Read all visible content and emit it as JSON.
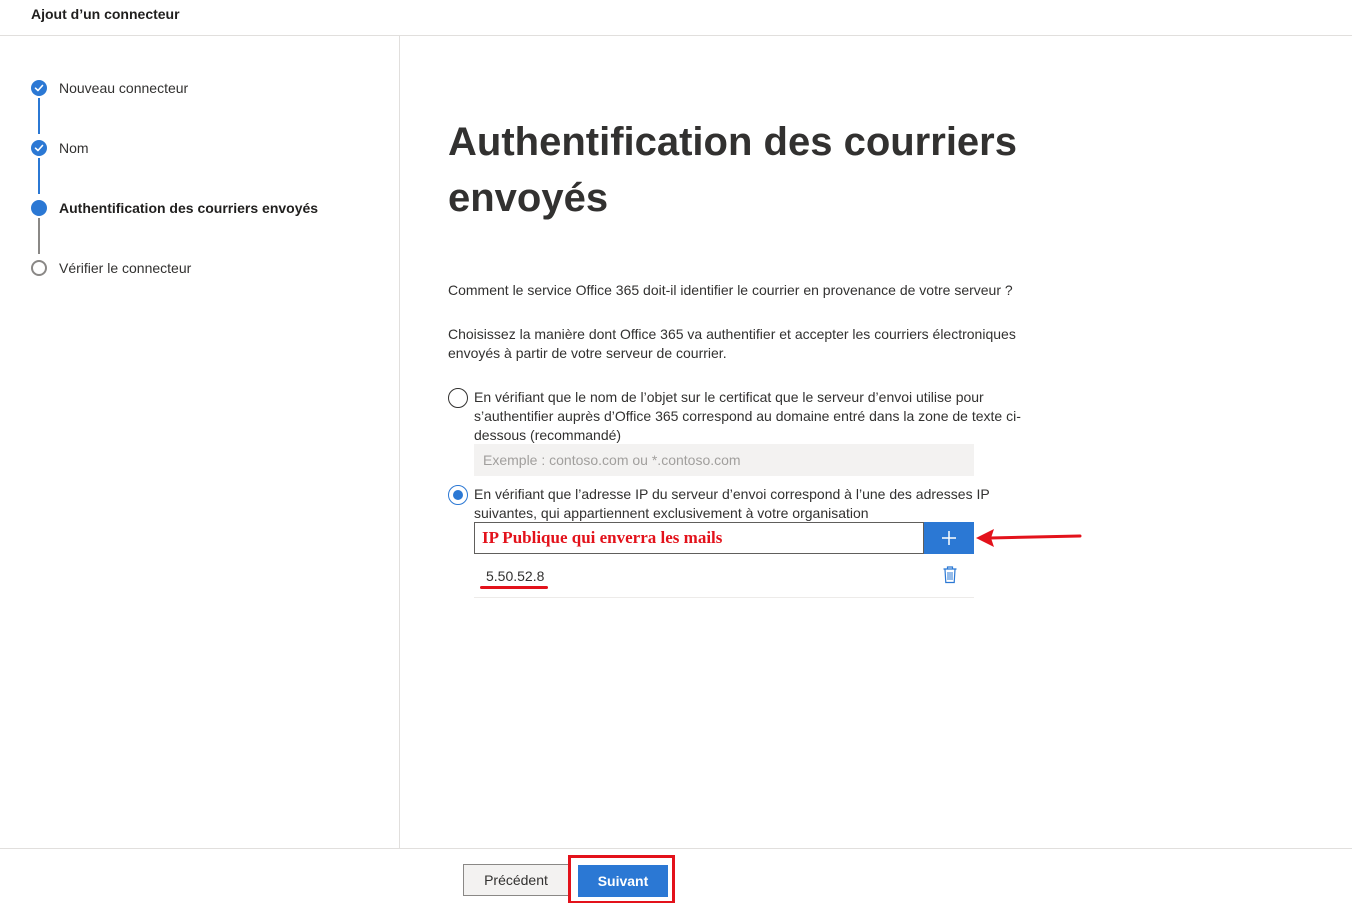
{
  "header": {
    "title": "Ajout d’un connecteur"
  },
  "steps": [
    {
      "label": "Nouveau connecteur",
      "state": "done"
    },
    {
      "label": "Nom",
      "state": "done"
    },
    {
      "label": "Authentification des courriers envoyés",
      "state": "current"
    },
    {
      "label": "Vérifier le connecteur",
      "state": "pending"
    }
  ],
  "main": {
    "heading": "Authentification des courriers envoyés",
    "question": "Comment le service Office 365 doit-il identifier le courrier en provenance de votre serveur ?",
    "instruction": "Choisissez la manière dont Office 365 va authentifier et accepter les courriers électroniques envoyés à partir de votre serveur de courrier.",
    "option_certificate": {
      "label": "En vérifiant que le nom de l’objet sur le certificat que le serveur d’envoi utilise pour s’authentifier auprès d’Office 365 correspond au domaine entré dans la zone de texte ci-dessous (recommandé)",
      "selected": false,
      "placeholder": "Exemple : contoso.com ou *.contoso.com"
    },
    "option_ip": {
      "label": "En vérifiant que l’adresse IP du serveur d’envoi correspond à l’une des adresses IP suivantes, qui appartiennent exclusivement à votre organisation",
      "selected": true,
      "input_value": "IP Publique qui enverra les mails",
      "ip_list": [
        "5.50.52.8"
      ]
    }
  },
  "footer": {
    "prev_label": "Précédent",
    "next_label": "Suivant"
  },
  "colors": {
    "accent": "#2b78d4",
    "annotation": "#e3121b"
  },
  "icons": {
    "step_done": "checkmark-icon",
    "add": "plus-icon",
    "delete": "trash-icon"
  }
}
